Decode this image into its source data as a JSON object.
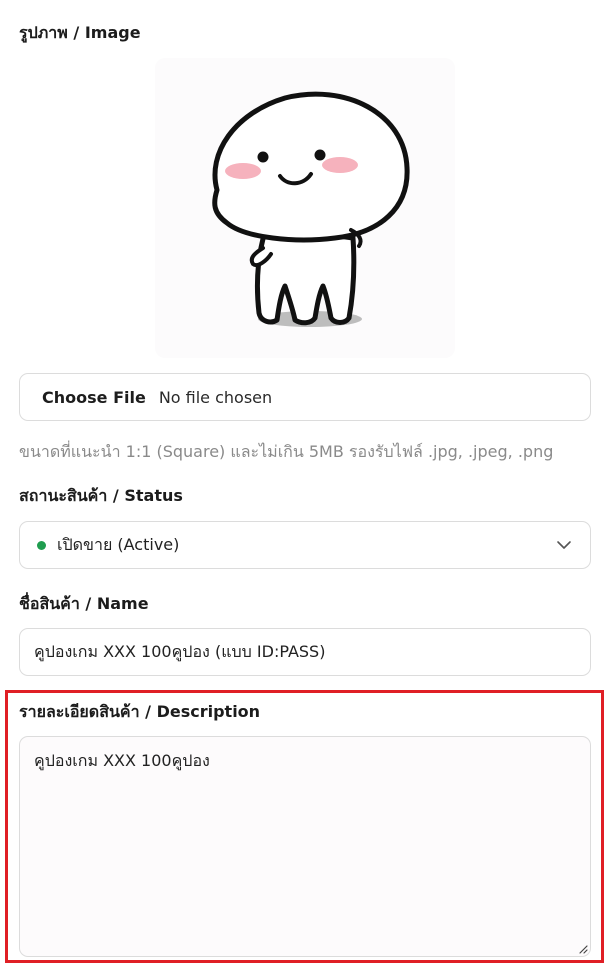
{
  "image_section": {
    "label": "รูปภาพ / Image",
    "preview_icon": "cute-white-character-image"
  },
  "file_input": {
    "button_label": "Choose File",
    "status": "No file chosen",
    "hint": "ขนาดที่แนะนำ 1:1 (Square) และไม่เกิน 5MB รองรับไฟล์ .jpg, .jpeg, .png"
  },
  "status_field": {
    "label": "สถานะสินค้า / Status",
    "selected": "เปิดขาย (Active)",
    "indicator_color": "#1f9d4f",
    "icon": "chevron-down-icon"
  },
  "name_field": {
    "label": "ชื่อสินค้า / Name",
    "value": "คูปองเกม XXX 100คูปอง (แบบ ID:PASS)"
  },
  "description_field": {
    "label": "รายละเอียดสินค้า / Description",
    "value": "คูปองเกม XXX 100คูปอง",
    "highlight_color": "#e01f25"
  }
}
